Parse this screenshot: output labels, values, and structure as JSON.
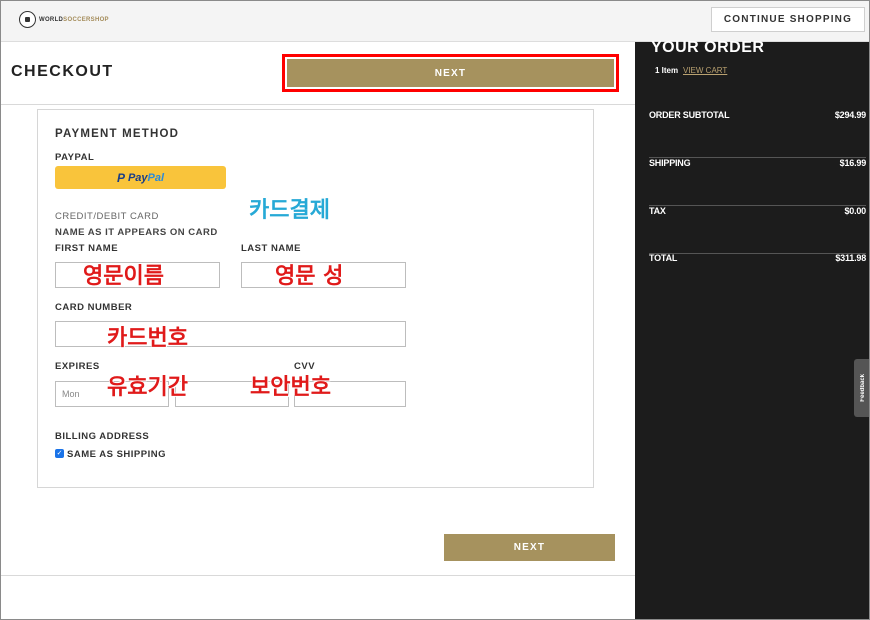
{
  "header": {
    "logo_text_a": "WORLD",
    "logo_text_b": "SOCCERSHOP",
    "continue_label": "CONTINUE SHOPPING"
  },
  "checkout": {
    "title": "CHECKOUT",
    "next_label": "NEXT"
  },
  "payment": {
    "section_title": "PAYMENT METHOD",
    "paypal_label": "PAYPAL",
    "paypal_button_a": "Pay",
    "paypal_button_b": "Pal",
    "card_label": "CREDIT/DEBIT CARD",
    "name_hint": "NAME AS IT APPEARS ON CARD",
    "first_name_label": "FIRST NAME",
    "last_name_label": "LAST NAME",
    "card_number_label": "CARD NUMBER",
    "expires_label": "EXPIRES",
    "cvv_label": "CVV",
    "expires_month_placeholder": "Mon",
    "billing_label": "BILLING ADDRESS",
    "same_as_shipping_label": "SAME AS SHIPPING",
    "same_as_shipping_checked": true
  },
  "annotations": {
    "card_payment": "카드결제",
    "first_name": "영문이름",
    "last_name": "영문 성",
    "card_number": "카드번호",
    "expiry": "유효기간",
    "security_code": "보안번호",
    "highlight_color": "#ff0000",
    "red_text_color": "#e01a1a",
    "blue_text_color": "#26a9d6"
  },
  "order": {
    "title": "YOUR ORDER",
    "items_count": "1 Item",
    "view_cart": "VIEW CART",
    "rows": [
      {
        "label": "ORDER SUBTOTAL",
        "value": "$294.99"
      },
      {
        "label": "SHIPPING",
        "value": "$16.99"
      },
      {
        "label": "TAX",
        "value": "$0.00"
      },
      {
        "label": "TOTAL",
        "value": "$311.98"
      }
    ]
  },
  "feedback_label": "Feedback",
  "colors": {
    "accent": "#a6925e",
    "sidebar_bg": "#1c1c1c",
    "paypal_yellow": "#f9c43b"
  }
}
